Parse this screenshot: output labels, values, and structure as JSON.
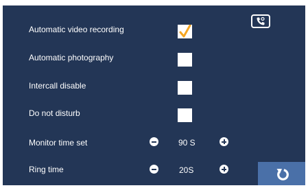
{
  "settings": {
    "auto_video_label": "Automatic video recording",
    "auto_photo_label": "Automatic photography",
    "intercall_label": "Intercall disable",
    "dnd_label": "Do not disturb",
    "monitor_time_label": "Monitor time set",
    "monitor_time_value": "90 S",
    "ring_time_label": "Ring time",
    "ring_time_value": "20S"
  },
  "checkboxes": {
    "auto_video": true,
    "auto_photo": false,
    "intercall": false,
    "dnd": false
  },
  "icons": {
    "phone": "phone-icon",
    "back": "back-arrow-icon",
    "minus": "minus-icon",
    "plus": "plus-icon",
    "check": "checkmark-icon"
  },
  "colors": {
    "background": "#233656",
    "accent_button": "#4a70a8",
    "checkmark": "#f5a623",
    "text": "#ffffff"
  }
}
